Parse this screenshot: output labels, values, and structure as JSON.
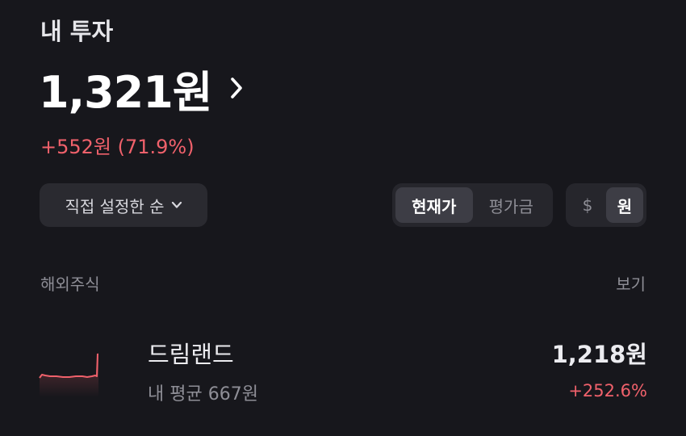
{
  "header": {
    "title": "내 투자"
  },
  "summary": {
    "total_value": "1,321원",
    "profit_text": "+552원 (71.9%)"
  },
  "controls": {
    "sort_label": "직접 설정한 순",
    "price_mode": {
      "options": [
        "현재가",
        "평가금"
      ],
      "selected": "현재가"
    },
    "currency": {
      "options": [
        "$",
        "원"
      ],
      "selected": "원"
    }
  },
  "group": {
    "label": "해외주식",
    "view_label": "보기"
  },
  "stocks": [
    {
      "name": "드림랜드",
      "average_price": "내 평균 667원",
      "price": "1,218원",
      "change": "+252.6%",
      "sparkline_icon": "sparkline-chart"
    }
  ],
  "colors": {
    "background": "#17171c",
    "positive": "#f0616b",
    "muted": "#8e8e96",
    "chip_bg": "#2a2a30"
  }
}
